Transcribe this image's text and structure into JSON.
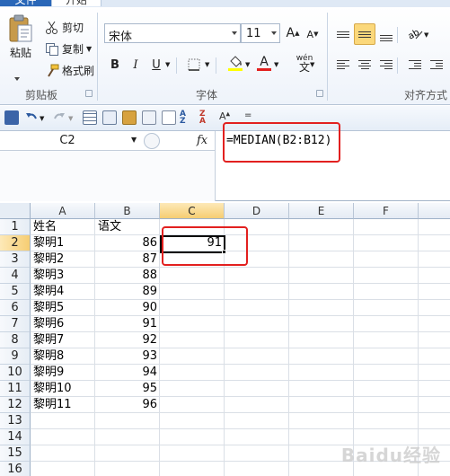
{
  "tabs": {
    "file": "文件",
    "home": "开始"
  },
  "ribbon": {
    "clipboard": {
      "paste": "粘贴",
      "cut": "剪切",
      "copy": "复制",
      "format_painter": "格式刷",
      "label": "剪贴板"
    },
    "font": {
      "font_name": "宋体",
      "font_size": "11",
      "grow": "A",
      "shrink": "A",
      "bold": "B",
      "italic": "I",
      "underline": "U",
      "font_color": "A",
      "phonetic": "wén",
      "label": "字体"
    },
    "alignment": {
      "label": "对齐方式"
    }
  },
  "formula_bar": {
    "name_box": "C2",
    "fx": "fx",
    "formula": "=MEDIAN(B2:B12)"
  },
  "sheet": {
    "columns": [
      "A",
      "B",
      "C",
      "D",
      "E",
      "F"
    ],
    "selected_column": "C",
    "selected_row": "2",
    "rows": [
      {
        "n": "1",
        "a": "姓名",
        "b": "语文",
        "c": ""
      },
      {
        "n": "2",
        "a": "黎明1",
        "b": "86",
        "c": "91"
      },
      {
        "n": "3",
        "a": "黎明2",
        "b": "87",
        "c": ""
      },
      {
        "n": "4",
        "a": "黎明3",
        "b": "88",
        "c": ""
      },
      {
        "n": "5",
        "a": "黎明4",
        "b": "89",
        "c": ""
      },
      {
        "n": "6",
        "a": "黎明5",
        "b": "90",
        "c": ""
      },
      {
        "n": "7",
        "a": "黎明6",
        "b": "91",
        "c": ""
      },
      {
        "n": "8",
        "a": "黎明7",
        "b": "92",
        "c": ""
      },
      {
        "n": "9",
        "a": "黎明8",
        "b": "93",
        "c": ""
      },
      {
        "n": "10",
        "a": "黎明9",
        "b": "94",
        "c": ""
      },
      {
        "n": "11",
        "a": "黎明10",
        "b": "95",
        "c": ""
      },
      {
        "n": "12",
        "a": "黎明11",
        "b": "96",
        "c": ""
      },
      {
        "n": "13",
        "a": "",
        "b": "",
        "c": ""
      },
      {
        "n": "14",
        "a": "",
        "b": "",
        "c": ""
      },
      {
        "n": "15",
        "a": "",
        "b": "",
        "c": ""
      },
      {
        "n": "16",
        "a": "",
        "b": "",
        "c": ""
      }
    ]
  },
  "watermark": "Baidu经验",
  "colors": {
    "accent_red": "#e2201f",
    "selected_header": "#f6cd72",
    "file_tab": "#2a67b8"
  }
}
